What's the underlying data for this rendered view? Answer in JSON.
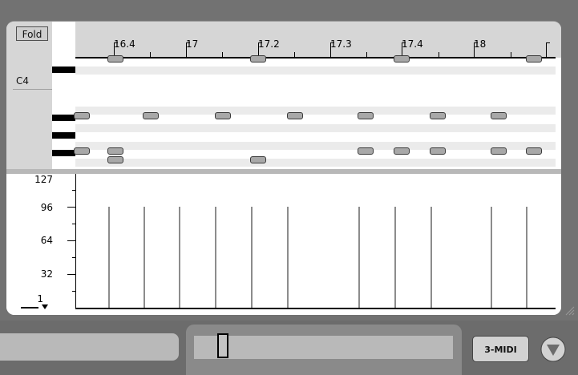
{
  "toolbar": {
    "fold_label": "Fold"
  },
  "keyboard": {
    "c4_label": "C4"
  },
  "ruler": {
    "labels": [
      "16.4",
      "17",
      "17.2",
      "17.3",
      "17.4",
      "18"
    ]
  },
  "velocity": {
    "labels": [
      "127",
      "96",
      "64",
      "32",
      "1"
    ]
  },
  "bottom": {
    "track_name": "3-MIDI"
  },
  "icons": {
    "toggle": "triangle-down-icon",
    "resize": "resize-grip-icon"
  },
  "colors": {
    "note_fill": "#a8a8a8",
    "velocity_bar": "#8c8c8c",
    "panel": "#d6d6d6"
  }
}
